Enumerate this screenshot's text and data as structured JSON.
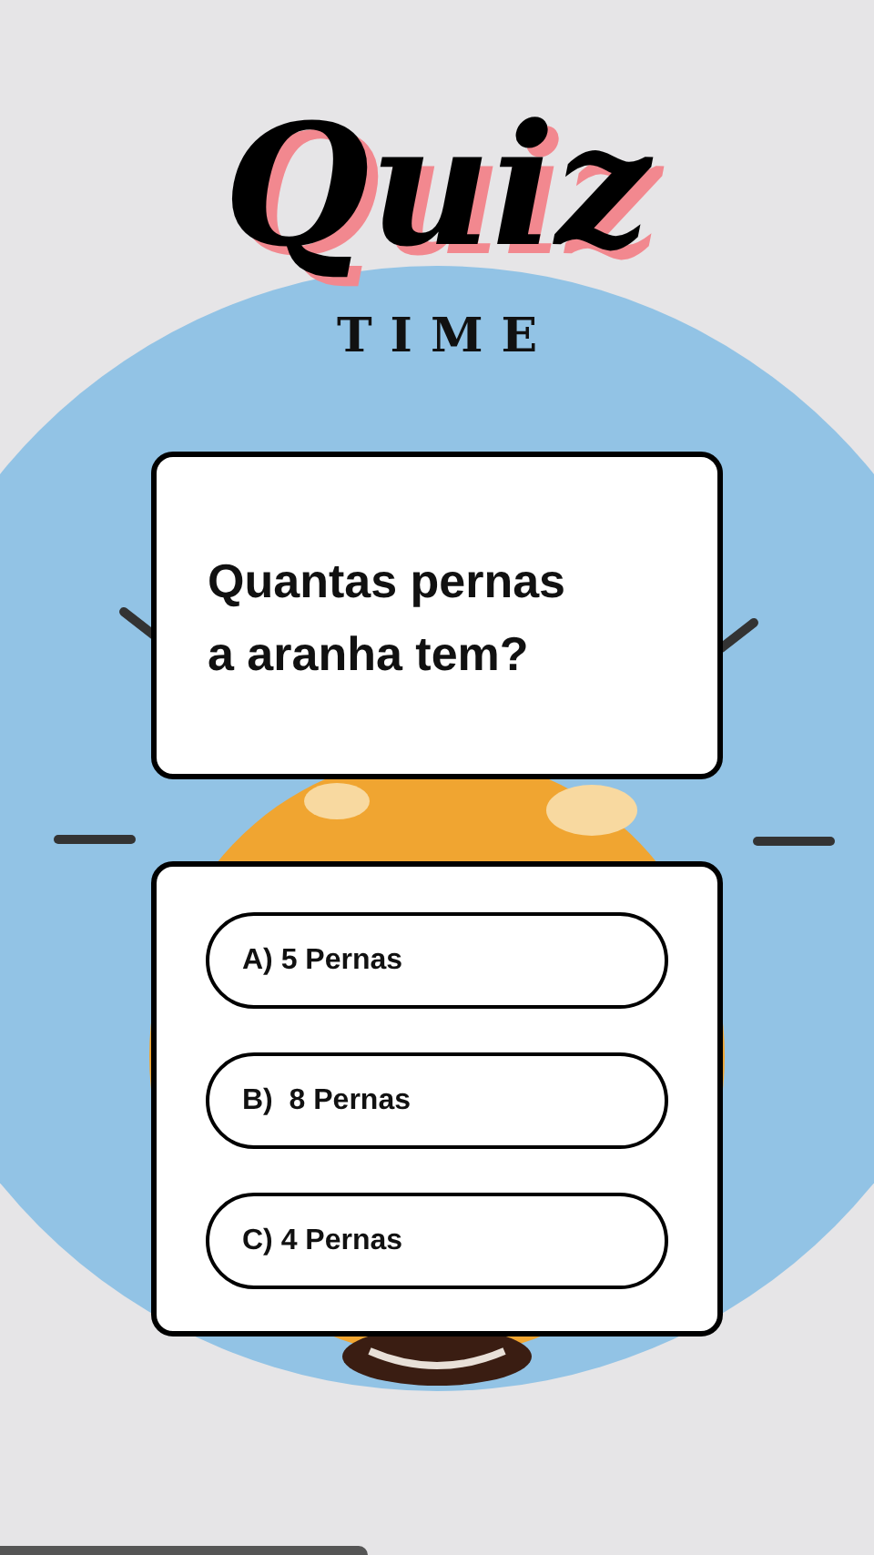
{
  "title": {
    "script": "Quiz",
    "subtitle": "TIME"
  },
  "question": "Quantas pernas a aranha tem?",
  "answers": [
    {
      "label": "A) 5 Pernas"
    },
    {
      "label": "B)  8 Pernas"
    },
    {
      "label": "C) 4 Pernas"
    }
  ]
}
